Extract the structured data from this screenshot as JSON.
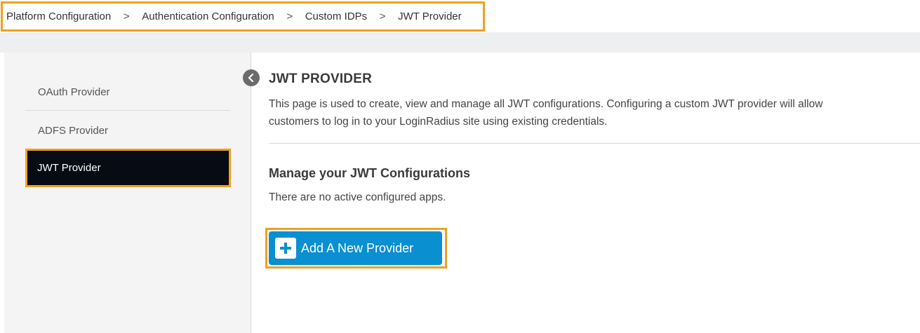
{
  "breadcrumb": {
    "items": [
      "Platform Configuration",
      "Authentication Configuration",
      "Custom IDPs",
      "JWT Provider"
    ],
    "separator": ">"
  },
  "sidebar": {
    "items": [
      {
        "label": "OAuth Provider",
        "active": false
      },
      {
        "label": "ADFS Provider",
        "active": false
      },
      {
        "label": "JWT Provider",
        "active": true
      }
    ],
    "collapse_icon": "chevron-left-icon"
  },
  "main": {
    "title": "JWT PROVIDER",
    "description": "This page is used to create, view and manage all JWT configurations. Configuring a custom JWT provider will allow customers to log in to your LoginRadius site using existing credentials.",
    "section_title": "Manage your JWT Configurations",
    "empty_text": "There are no active configured apps.",
    "add_button_label": "Add A New Provider",
    "add_button_icon": "plus-icon"
  },
  "colors": {
    "highlight": "#f0a020",
    "primary_button": "#0a8fd1",
    "active_sidebar": "#060b14"
  }
}
